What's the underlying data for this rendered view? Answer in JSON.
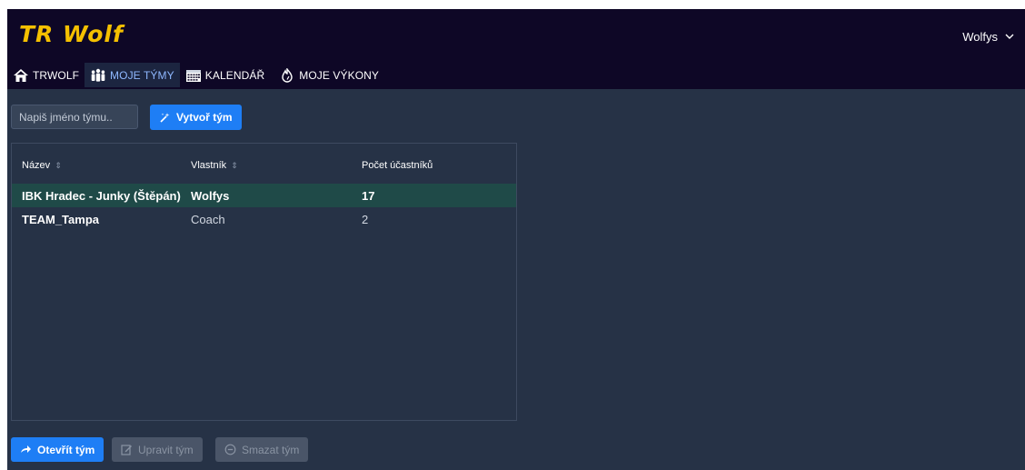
{
  "app": {
    "logo": "TR Wolf",
    "user": "Wolfys"
  },
  "nav": [
    {
      "label": "TRWOLF",
      "icon": "home-icon",
      "active": false
    },
    {
      "label": "MOJE TÝMY",
      "icon": "team-icon",
      "active": true
    },
    {
      "label": "KALENDÁŘ",
      "icon": "calendar-icon",
      "active": false
    },
    {
      "label": "MOJE VÝKONY",
      "icon": "performance-icon",
      "active": false
    }
  ],
  "create": {
    "placeholder": "Napiš jméno týmu..",
    "value": "",
    "button": "Vytvoř tým"
  },
  "table": {
    "columns": [
      "Název",
      "Vlastník",
      "Počet účastníků"
    ],
    "rows": [
      {
        "name": "IBK Hradec - Junky (Štěpán)",
        "owner": "Wolfys",
        "count": "17",
        "selected": true
      },
      {
        "name": "TEAM_Tampa",
        "owner": "Coach",
        "count": "2",
        "selected": false
      }
    ]
  },
  "actions": {
    "open": "Otevřít tým",
    "edit": "Upravit tým",
    "delete": "Smazat tým"
  },
  "colors": {
    "brand": "#f5c000",
    "primary": "#1e7ef5",
    "selected_row": "#1f4a48",
    "topbar": "#0e0726",
    "background": "#263246"
  }
}
